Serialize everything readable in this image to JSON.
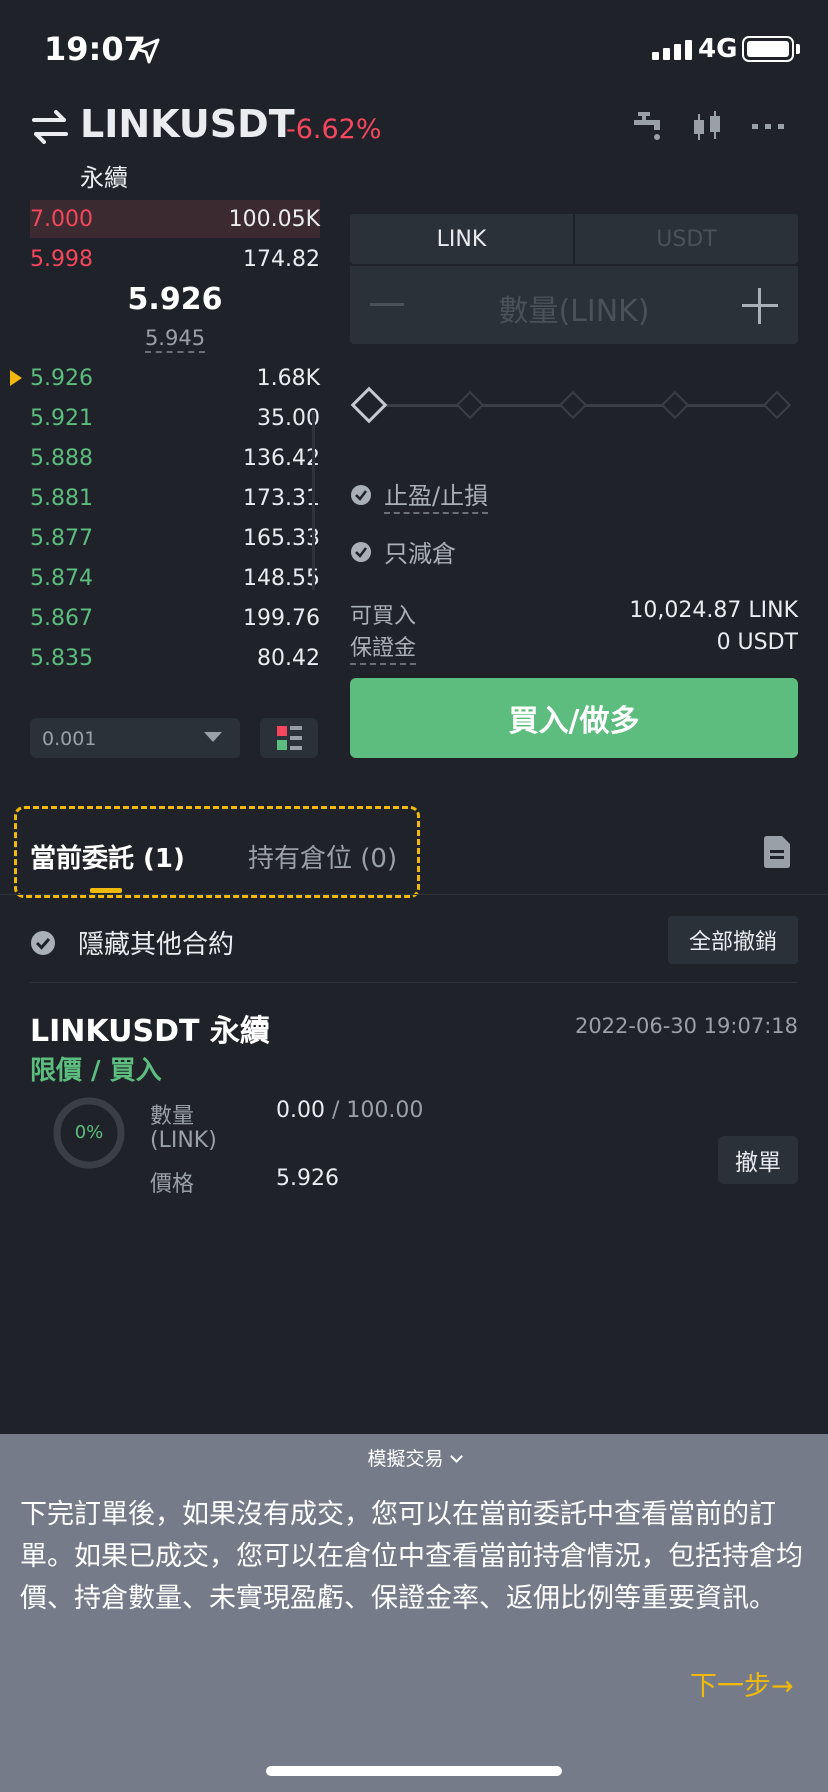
{
  "status_bar": {
    "time": "19:07",
    "network": "4G"
  },
  "header": {
    "symbol": "LINKUSDT",
    "change": "-6.62%",
    "contract_type": "永續"
  },
  "order_book": {
    "asks": [
      {
        "price": "7.000",
        "qty": "100.05K"
      },
      {
        "price": "5.998",
        "qty": "174.82"
      }
    ],
    "last_price": "5.926",
    "mark_price": "5.945",
    "bids": [
      {
        "price": "5.926",
        "qty": "1.68K"
      },
      {
        "price": "5.921",
        "qty": "35.00"
      },
      {
        "price": "5.888",
        "qty": "136.42"
      },
      {
        "price": "5.881",
        "qty": "173.31"
      },
      {
        "price": "5.877",
        "qty": "165.33"
      },
      {
        "price": "5.874",
        "qty": "148.55"
      },
      {
        "price": "5.867",
        "qty": "199.76"
      },
      {
        "price": "5.835",
        "qty": "80.42"
      }
    ],
    "precision": "0.001"
  },
  "order_form": {
    "unit_tabs": [
      "LINK",
      "USDT"
    ],
    "quantity_placeholder": "數量(LINK)",
    "tp_sl_label": "止盈/止損",
    "reduce_only_label": "只減倉",
    "available_label": "可買入",
    "available_value": "10,024.87 LINK",
    "margin_label": "保證金",
    "margin_value": "0 USDT",
    "buy_label": "買入/做多"
  },
  "tabs": {
    "current_orders": "當前委託 (1)",
    "positions": "持有倉位 (0)"
  },
  "filter": {
    "hide_other": "隱藏其他合約",
    "cancel_all": "全部撤銷"
  },
  "order": {
    "title": "LINKUSDT 永續",
    "type": "限價 / 買入",
    "time": "2022-06-30 19:07:18",
    "progress": "0%",
    "qty_label_1": "數量",
    "qty_label_2": "(LINK)",
    "filled": "0.00",
    "total": " / 100.00",
    "price_label": "價格",
    "price": "5.926",
    "cancel": "撤單"
  },
  "tutorial": {
    "title": "模擬交易",
    "body": "下完訂單後，如果沒有成交，您可以在當前委託中查看當前的訂單。如果已成交，您可以在倉位中查看當前持倉情況，包括持倉均價、持倉數量、未實現盈虧、保證金率、返佣比例等重要資訊。",
    "next": "下一步→"
  },
  "colors": {
    "buy": "#5cbd7f",
    "sell": "#f6465d",
    "accent": "#f0b90b",
    "background": "#1f2329"
  }
}
